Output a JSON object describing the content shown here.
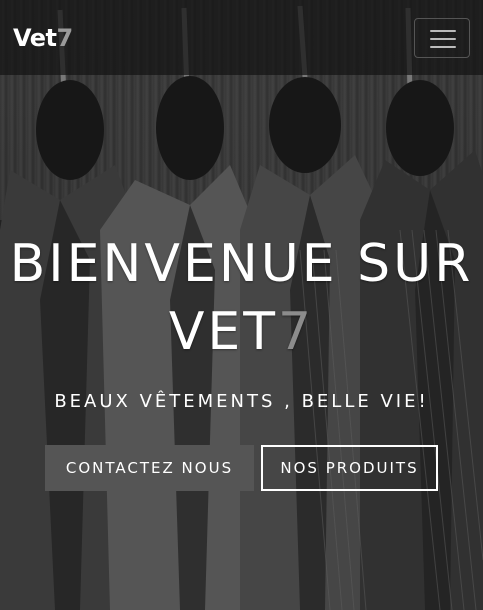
{
  "nav": {
    "brand_text": "Vet",
    "brand_accent": "7",
    "menu_icon": "hamburger-menu-icon"
  },
  "hero": {
    "headline_line1": "BIENVENUE SUR",
    "headline_line2": "VET",
    "headline_accent": "7",
    "tagline": "BEAUX VÊTEMENTS , BELLE VIE!",
    "contact_button": "CONTACTEZ NOUS",
    "products_button": "NOS PRODUITS"
  },
  "colors": {
    "brand_accent": "#9a9a9a",
    "contact_button_bg": "#555555",
    "navbar_bg": "rgba(20,20,20,0.72)"
  }
}
